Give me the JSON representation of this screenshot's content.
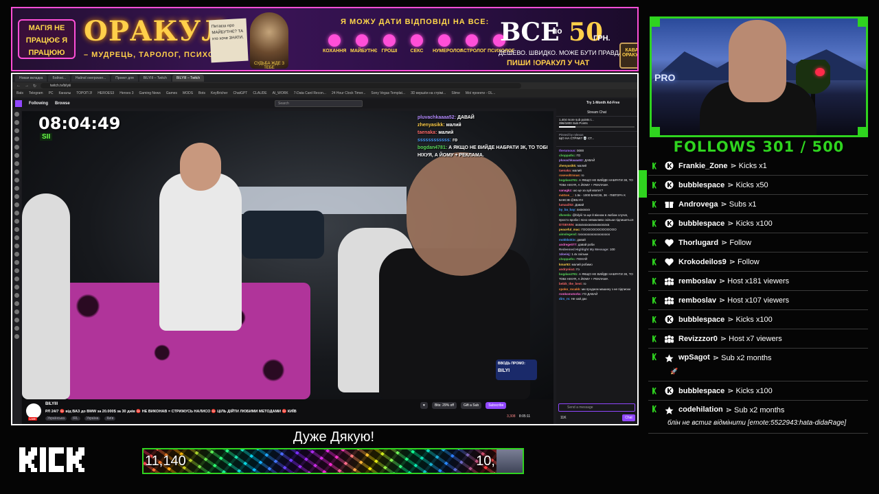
{
  "banner": {
    "sign_text": "МАГІЯ НЕ ПРАЦЮЄ Я ПРАЦЮЮ",
    "brand": "ОРАКУЛ",
    "brand_sub": "– МУДРЕЦЬ, ТАРОЛОГ, ПСИХОЛОГ –",
    "note_text": "Питаєш про МАЙБУТНЄ? ТА хто хоче ЗНАТИ.",
    "wizard_caption": "СУДЬБА ЖДЕ З ТЕБЕ",
    "answer_line": "Я МОЖУ ДАТИ ВІДПОВІДІ НА ВСЕ:",
    "categories": [
      "КОХАННЯ",
      "МАЙБУТНЄ",
      "ГРОШІ",
      "СЕКС",
      "НУМЕРОЛОГ",
      "АСТРОЛОГ",
      "ПСИХОЛОГ"
    ],
    "price_all": "ВСЕ",
    "price_by": "по",
    "price_num": "50",
    "price_unit": "ГРН.",
    "cheap_line": "ДЕШЕВО. ШВИДКО. МОЖЕ БУТИ ПРАВДА.",
    "write_line": "ПИШИ !ОРАКУЛ У ЧАТ",
    "mug_text": "КАВА ОРАКУЛ"
  },
  "browser": {
    "tabs": [
      "Новая вкладка",
      "Бойові...",
      "Hatinol overpower...",
      "Проект для",
      "BILYIII – Twitch",
      "BILYIII – Twitch"
    ],
    "active_tab": 5,
    "url": "twitch.tv/bilyiii",
    "bookmarks": [
      "Bats",
      "Telegram",
      "PC",
      "Каналы",
      "ТОРОП 3!",
      "HEROES3",
      "Heroes 3",
      "Gaming News",
      "Games",
      "MODS",
      "Bots",
      "KeyBricher",
      "ChatGPT",
      "CLAUDE",
      "AI_WORK",
      "7-Data Card Recon...",
      "24 Hour Clock Timer...",
      "Sony Vegas Templat...",
      "3D вершёи на стрімі...",
      "Slime",
      "Мої проекти - OL..."
    ]
  },
  "twitch": {
    "following": "Following",
    "browse": "Browse",
    "search_placeholder": "Search",
    "ad_free": "Try 1-Month Ad-Free",
    "video": {
      "clock": "08:04:49",
      "battery": "SII",
      "overlay_chat": [
        {
          "user": "pluvachkaaaa52",
          "text": "ДАВАЙ"
        },
        {
          "user": "zhenyasikk",
          "text": "малий"
        },
        {
          "user": "taenaka",
          "text": "малий"
        },
        {
          "user": "ssssssssssss",
          "text": "го"
        },
        {
          "user": "bogdan4781",
          "text": "А ЯКЩО НЕ ВИЙДЕ НАБРАТИ 3К, ТО ТОБІ НІХУЯ, А ЙОМУ + РЕКЛАМА."
        }
      ],
      "promo_label": "ВВОДЬ ПРОМО:",
      "promo_code": "BILYI"
    },
    "stream": {
      "channel": "BILYIII",
      "live": "LIVE",
      "title": "РЛ 24/7 ⛔ від ВАЗ до BMW за 20.000$ за 30 днів ⛔ НЕ ВИКОНАВ = СТРИЖУСЬ НАЛИСО ⛔ ЦІЛЬ ДІЙТИ ЛЮБИМИ МЕТОДАМИ ⛔ КИЇВ",
      "tags": [
        "Українська",
        "IRL",
        "Україна",
        "Київ"
      ],
      "bits": "Bits: 29% off",
      "gift": "Gift a Sub",
      "subscribe": "Subscribe",
      "viewers": "3,308",
      "uptime": "8:05:11"
    },
    "chat": {
      "header": "Stream Chat",
      "goal": "1,404 more sub points t...",
      "goal_progress": "396/1800 Sub Points",
      "goal_fraction": 0.22,
      "pinned_by": "Pinned by rylexus",
      "pinned_text": "ЩО НА СТРІМІ? 💀 СТ...",
      "messages": [
        {
          "user": "therumous",
          "text": "0000",
          "color": "#a66bff"
        },
        {
          "user": "choppathc",
          "text": "ГО",
          "color": "#5ad85a"
        },
        {
          "user": "pluvachkaaaa52",
          "text": "ДАВАЙ",
          "color": "#b58cff"
        },
        {
          "user": "zhenyasikk",
          "text": "малий",
          "color": "#ffcf4a"
        },
        {
          "user": "taenaka",
          "text": "малий",
          "color": "#ff6b6b"
        },
        {
          "user": "rosevoltrnnas",
          "text": "го",
          "color": "#ff8a3a"
        },
        {
          "user": "bogdan4781",
          "text": "А ЯКЩО НЕ ВИЙДЕ НАБРАТИ 3К, ТО ТОБІ НІХУЯ, А ЙОМУ + РЕКЛАМА",
          "color": "#5ad85a"
        },
        {
          "user": "sanagkz",
          "text": "шо це за хуй кватит?",
          "color": "#ff6bd5"
        },
        {
          "user": "m4Gos__",
          "text": "1.5к - 1000 БАКСІВ, 3К - ПІВТОРА К БАКСІВ @BILYIII",
          "color": "#ff8a3a"
        },
        {
          "user": "lumaxil02",
          "text": "Давай",
          "color": "#ff6b6b"
        },
        {
          "user": "by_ba_bay",
          "text": "ахахахха",
          "color": "#4a9dff"
        },
        {
          "user": "dlveeda",
          "text": "@bilyiii та ще й вікном в любом случаї, просто вроби і ясно неважливо скільки підпишеться",
          "color": "#5ad85a"
        },
        {
          "user": "D7SEVEN",
          "text": "ахахахахахахахахахаха",
          "color": "#ff6b6b"
        },
        {
          "user": "peaceful_mac",
          "text": "ГОООООООООООООО",
          "color": "#ffcf4a"
        },
        {
          "user": "aimslegend",
          "text": "гоооооооооооооооооо",
          "color": "#5ad85a"
        },
        {
          "user": "mokkkokin",
          "text": "давай",
          "color": "#4a9dff"
        },
        {
          "user": "andrege077",
          "text": "давай роби",
          "color": "#ff6bd5"
        },
        {
          "user": "Redeemed Highlight My Message",
          "text": "100",
          "color": "#adadb8"
        },
        {
          "user": "1doeisj",
          "text": "1.4к скільки",
          "color": "#b58cff"
        },
        {
          "user": "choppathc",
          "text": "ПОХУЙ",
          "color": "#5ad85a"
        },
        {
          "user": "kmar93",
          "text": "малий робимо",
          "color": "#ffcf4a"
        },
        {
          "user": "andryniia1",
          "text": "Го",
          "color": "#ff6b6b"
        },
        {
          "user": "bogdan4781",
          "text": "А ЯКЩО НЕ ВИЙДЕ НАБРАТИ 3К, ТО ТОБІ НІХУЯ, А ЙОМУ + РЕКЛАМА",
          "color": "#5ad85a"
        },
        {
          "user": "bebik_the_best",
          "text": "го",
          "color": "#ff6b6b"
        },
        {
          "user": "cpoko_rocakk",
          "text": "ми продаєм машину з не підписки",
          "color": "#ff8a3a"
        },
        {
          "user": "romkomotorks",
          "text": "ГО ДАВАЙ",
          "color": "#ff6bd5"
        },
        {
          "user": "dirs_rs",
          "text": "Не хай дає",
          "color": "#4a9dff"
        }
      ],
      "input_placeholder": "Send a message",
      "points": "11K",
      "chat_button": "Chat"
    }
  },
  "overlay": {
    "thanks": "Дуже Дякую!",
    "progress_current": "11,140",
    "progress_target": "10,",
    "follows_label": "FOLLOWS 301 / 500",
    "events": [
      {
        "icon": "kick-icon",
        "user": "Frankie_Zone",
        "action": "⋗ Kicks x1"
      },
      {
        "icon": "kick-icon",
        "user": "bubblespace",
        "action": "⋗ Kicks x50"
      },
      {
        "icon": "gift-icon",
        "user": "Androvega",
        "action": "⋗ Subs x1"
      },
      {
        "icon": "kick-icon",
        "user": "bubblespace",
        "action": "⋗ Kicks x100"
      },
      {
        "icon": "heart-icon",
        "user": "Thorlugard",
        "action": "⋗ Follow"
      },
      {
        "icon": "heart-icon",
        "user": "Krokodeilos9",
        "action": "⋗ Follow"
      },
      {
        "icon": "host-icon",
        "user": "remboslav",
        "action": "⋗ Host x181 viewers"
      },
      {
        "icon": "host-icon",
        "user": "remboslav",
        "action": "⋗ Host x107 viewers"
      },
      {
        "icon": "kick-icon",
        "user": "bubblespace",
        "action": "⋗ Kicks x100"
      },
      {
        "icon": "host-icon",
        "user": "Revizzzor0",
        "action": "⋗ Host x7 viewers"
      },
      {
        "icon": "star-icon",
        "user": "wpSagot",
        "action": "⋗ Sub x2 months",
        "extra": "🚀"
      },
      {
        "icon": "kick-icon",
        "user": "bubblespace",
        "action": "⋗ Kicks x100"
      },
      {
        "icon": "star-icon",
        "user": "codehilation",
        "action": "⋗ Sub x2 months",
        "message": "блін не встиг відмінити [emote:5522943:hata-didaRage]"
      }
    ],
    "webcam_sign": "PRO"
  }
}
